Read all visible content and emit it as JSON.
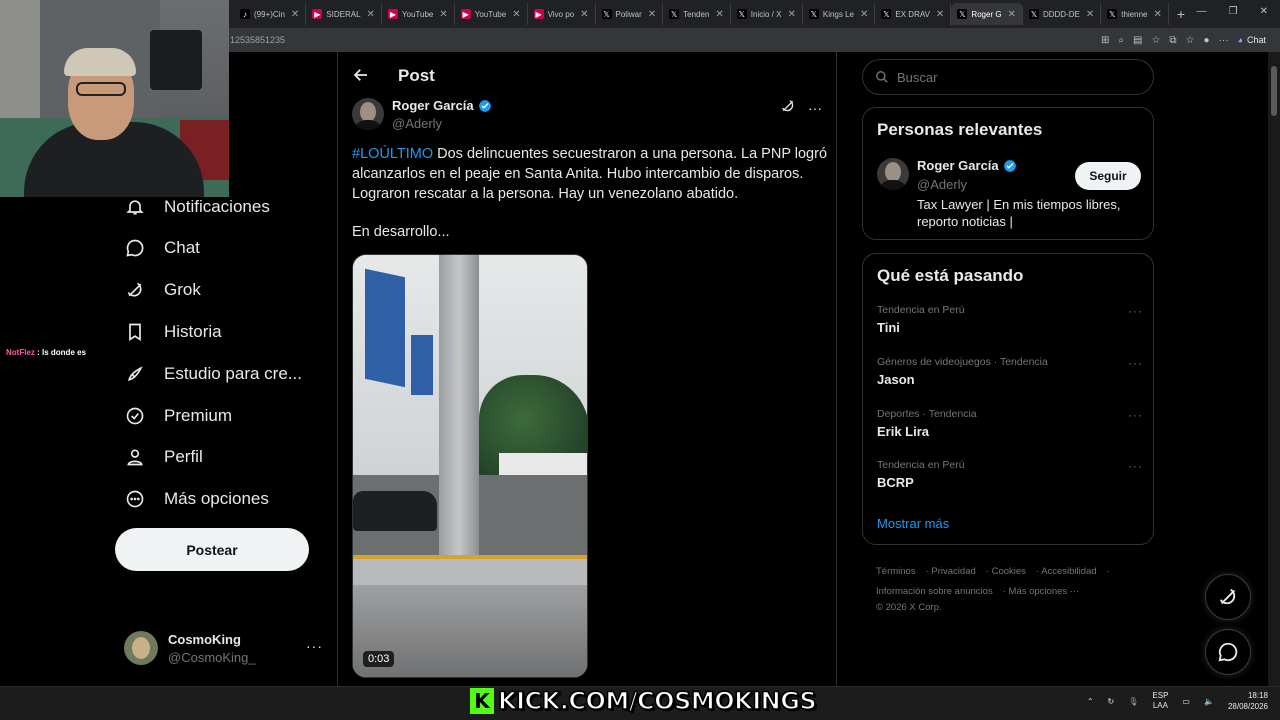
{
  "browser": {
    "tabs": [
      {
        "label": "(99+)Cin",
        "color": "#000000",
        "icon": "tiktok-icon"
      },
      {
        "label": "SIDERAL",
        "color": "#d1004a",
        "icon": "twitch-icon"
      },
      {
        "label": "YouTube",
        "color": "#d1004a",
        "icon": "youtube-icon"
      },
      {
        "label": "YouTube",
        "color": "#d1004a",
        "icon": "youtube-icon"
      },
      {
        "label": "Vivo po",
        "color": "#d1004a",
        "icon": "youtube-icon"
      },
      {
        "label": "Poliwar",
        "color": "#000000",
        "icon": "x-logo-icon"
      },
      {
        "label": "Tenden",
        "color": "#000000",
        "icon": "x-logo-icon"
      },
      {
        "label": "Inicio / X",
        "color": "#000000",
        "icon": "x-logo-icon"
      },
      {
        "label": "Kings Le",
        "color": "#000000",
        "icon": "x-logo-icon"
      },
      {
        "label": "EX DRAV",
        "color": "#000000",
        "icon": "x-logo-icon"
      },
      {
        "label": "Roger G",
        "color": "#000000",
        "icon": "x-logo-icon",
        "active": true
      },
      {
        "label": "DDDD-DE",
        "color": "#000000",
        "icon": "x-logo-icon"
      },
      {
        "label": "thienne",
        "color": "#000000",
        "icon": "x-logo-icon"
      }
    ],
    "url_fragment": "12535851235",
    "chat_label": "Chat"
  },
  "stream": {
    "chat_nick": "NotFlez",
    "chat_message": " : Is donde es",
    "kick_banner": "KICK.COM/COSMOKINGS",
    "kick_letter": "K"
  },
  "nav": {
    "items": [
      {
        "label": "Notificaciones",
        "icon": "bell-icon"
      },
      {
        "label": "Chat",
        "icon": "chat-bubble-icon"
      },
      {
        "label": "Grok",
        "icon": "grok-icon"
      },
      {
        "label": "Historia",
        "icon": "bookmark-icon"
      },
      {
        "label": "Estudio para cre...",
        "icon": "rocket-icon"
      },
      {
        "label": "Premium",
        "icon": "verified-badge-icon"
      },
      {
        "label": "Perfil",
        "icon": "person-icon"
      },
      {
        "label": "Más opciones",
        "icon": "more-circle-icon"
      }
    ],
    "post_button": "Postear",
    "account": {
      "name": "CosmoKing",
      "handle": "@CosmoKing_"
    }
  },
  "post": {
    "header_title": "Post",
    "author_name": "Roger García",
    "author_handle": "@Aderly",
    "hashtag": "#LOÚLTIMO",
    "body": " Dos delincuentes secuestraron a una persona. La PNP logró alcanzarlos en el peaje en Santa Anita. Hubo intercambio de disparos. Lograron rescatar a la persona. Hay un venezolano abatido.",
    "body2": "En desarrollo...",
    "video_time": "0:03"
  },
  "sidebar": {
    "search_placeholder": "Buscar",
    "relevant_title": "Personas relevantes",
    "relevant": {
      "name": "Roger García",
      "handle": "@Aderly",
      "bio": "Tax Lawyer | En mis tiempos libres, reporto noticias |",
      "follow_label": "Seguir"
    },
    "trends_title": "Qué está pasando",
    "trends": [
      {
        "meta": "Tendencia en Perú",
        "name": "Tini"
      },
      {
        "meta": "Géneros de videojuegos · Tendencia",
        "name": "Jason"
      },
      {
        "meta": "Deportes · Tendencia",
        "name": "Erik Lira"
      },
      {
        "meta": "Tendencia en Perú",
        "name": "BCRP"
      }
    ],
    "show_more": "Mostrar más",
    "footer": {
      "terms": "Términos",
      "privacy": "Privacidad",
      "cookies": "Cookies",
      "accessibility": "Accesibilidad",
      "ads_info": "Información sobre anuncios",
      "more": "Más opciones ···",
      "copyright": "© 2026 X Corp."
    }
  },
  "taskbar": {
    "lang_top": "ESP",
    "lang_bottom": "LAA",
    "time": "18:18",
    "date": "28/08/2026"
  },
  "colors": {
    "accent": "#1d9bf0",
    "kick_green": "#53fc18",
    "background": "#000000"
  }
}
